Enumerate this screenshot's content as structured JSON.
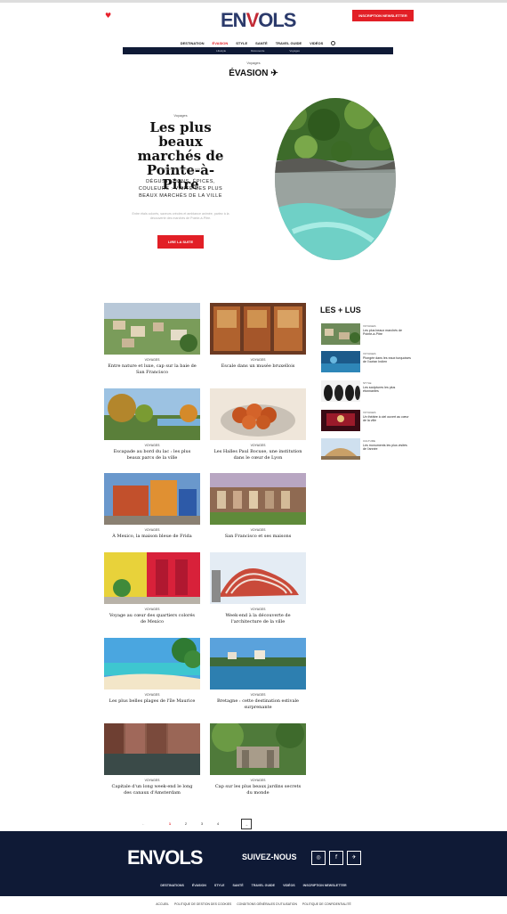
{
  "header": {
    "logo_left": "EN",
    "logo_v": "V",
    "logo_right": "OLS",
    "newsletter_label": "INSCRIPTION NEWSLETTER"
  },
  "main_nav": [
    "DESTINATION",
    "ÉVASION",
    "STYLE",
    "SANTÉ",
    "TRAVEL GUIDE",
    "VIDÉOS"
  ],
  "sub_nav": [
    "Lifestyle",
    "Découverte",
    "Voyages"
  ],
  "section": {
    "kicker": "Voyages",
    "title": "ÉVASION"
  },
  "hero": {
    "kicker": "Voyages",
    "title": "Les plus beaux marchés de Pointe-à-Pitre",
    "byline": "Rédaction Envols · 5 min",
    "lead": "DÉGUSTATIONS, ÉPICES, COULEURS : VISITE DES PLUS BEAUX MARCHÉS DE LA VILLE",
    "text": "Entre étals colorés, saveurs créoles et ambiance animée, partez à la découverte des marchés de Pointe-à-Pitre.",
    "button": "LIRE LA SUITE"
  },
  "articles": [
    {
      "category": "VOYAGES",
      "title": "Entre nature et luxe, cap sur la baie de San Francisco"
    },
    {
      "category": "VOYAGES",
      "title": "Escale dans un musée bruxellois"
    },
    {
      "category": "VOYAGES",
      "title": "Escapade au bord du lac : les plus beaux parcs de la ville"
    },
    {
      "category": "VOYAGES",
      "title": "Les Halles Paul Bocuse, une institution dans le cœur de Lyon"
    },
    {
      "category": "VOYAGES",
      "title": "À Mexico, la maison bleue de Frida"
    },
    {
      "category": "VOYAGES",
      "title": "San Francisco et ses maisons"
    },
    {
      "category": "VOYAGES",
      "title": "Voyage au cœur des quartiers colorés de Mexico"
    },
    {
      "category": "VOYAGES",
      "title": "Week-end à la découverte de l'architecture de la ville"
    },
    {
      "category": "VOYAGES",
      "title": "Les plus belles plages de l'île Maurice"
    },
    {
      "category": "VOYAGES",
      "title": "Bretagne : cette destination estivale surprenante"
    },
    {
      "category": "VOYAGES",
      "title": "Capitale d'un long week-end le long des canaux d'Amsterdam"
    },
    {
      "category": "VOYAGES",
      "title": "Cap sur les plus beaux jardins secrets du monde"
    }
  ],
  "les_plus_lus": {
    "title": "LES + LUS",
    "items": [
      {
        "category": "VOYAGES",
        "title": "Les plus beaux marchés de Pointe-à-Pitre"
      },
      {
        "category": "VOYAGES",
        "title": "Plongée dans les eaux turquoises de l'océan Indien"
      },
      {
        "category": "STYLE",
        "title": "Les sculptures les plus étonnantes"
      },
      {
        "category": "VOYAGES",
        "title": "Un théâtre à ciel ouvert au cœur de la ville"
      },
      {
        "category": "CULTURE",
        "title": "Les monuments les plus visités de l'année"
      }
    ]
  },
  "pagination": {
    "prev": "←",
    "pages": [
      "1",
      "2",
      "3",
      "4"
    ],
    "active": "1",
    "next": "→"
  },
  "footer": {
    "logo_left": "EN",
    "logo_v": "V",
    "logo_right": "OLS",
    "follow": "SUIVEZ-NOUS",
    "social": [
      "instagram",
      "facebook",
      "twitter"
    ],
    "nav": [
      "DESTINATIONS",
      "ÉVASION",
      "STYLE",
      "SANTÉ",
      "TRAVEL GUIDE",
      "VIDÉOS",
      "INSCRIPTION NEWSLETTER"
    ],
    "legal": [
      "ACCUEIL",
      "POLITIQUE DE GESTION DES COOKIES",
      "CONDITIONS GÉNÉRALES D'UTILISATION",
      "POLITIQUE DE CONFIDENTIALITÉ"
    ]
  }
}
